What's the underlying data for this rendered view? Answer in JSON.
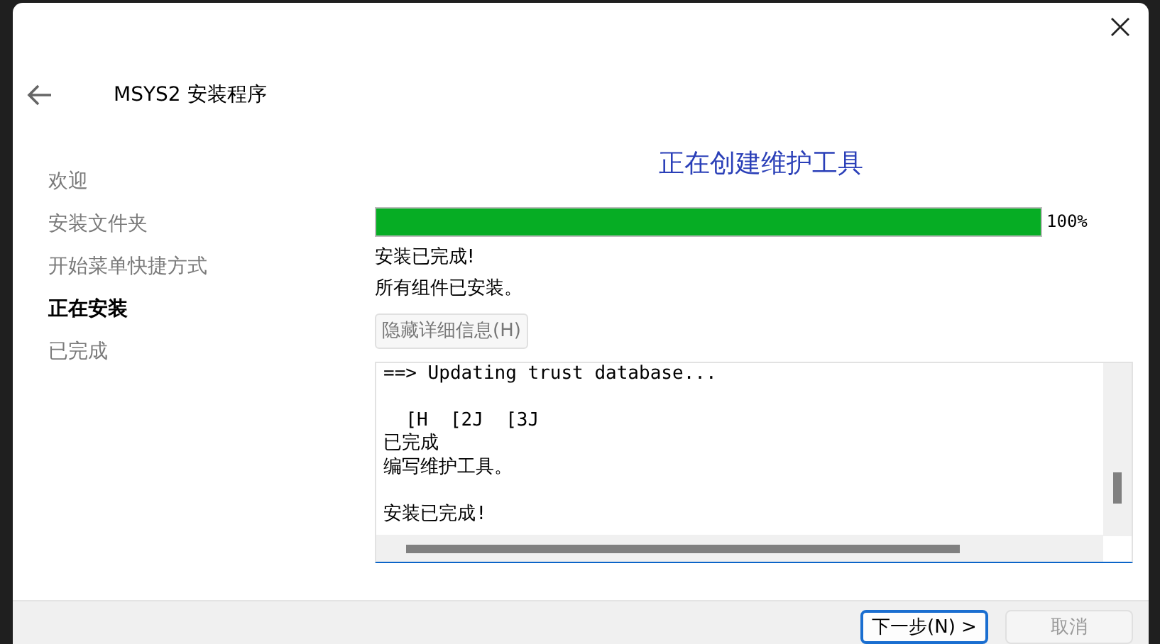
{
  "window": {
    "title": "MSYS2 安装程序"
  },
  "sidebar": {
    "items": [
      {
        "label": "欢迎",
        "selected": false
      },
      {
        "label": "安装文件夹",
        "selected": false
      },
      {
        "label": "开始菜单快捷方式",
        "selected": false
      },
      {
        "label": "正在安装",
        "selected": true
      },
      {
        "label": "已完成",
        "selected": false
      }
    ]
  },
  "page": {
    "heading": "正在创建维护工具",
    "progress": {
      "level": 1.0,
      "reading": "100%"
    },
    "messages": [
      "安装已完成!",
      "所有组件已安装。"
    ],
    "details_button": "隐藏详细信息(H)",
    "log": [
      {
        "lines": [
          "==> Updating trust database..."
        ]
      },
      {
        "lines": [
          "  [H  [2J  [3J",
          "已完成",
          "编写维护工具。"
        ]
      },
      {
        "lines": [
          "安装已完成!"
        ]
      }
    ]
  },
  "buttons": [
    {
      "label": "下一步(N) >",
      "default": true,
      "disabled": false
    },
    {
      "label": "取消",
      "default": false,
      "disabled": true
    }
  ]
}
